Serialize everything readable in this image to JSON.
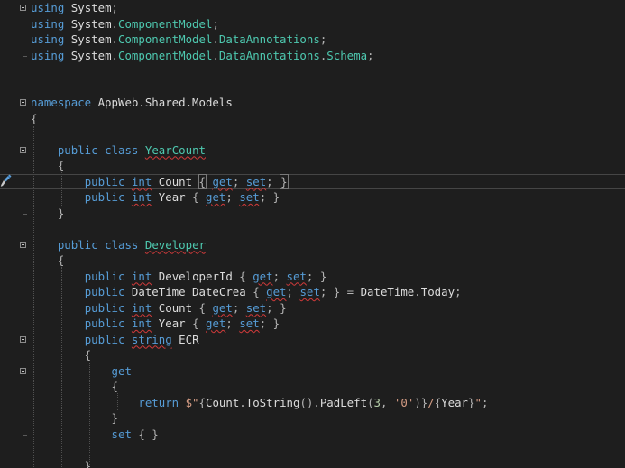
{
  "lines": [
    {
      "row": 0,
      "fold": true,
      "tokens": [
        [
          "kw",
          "using"
        ],
        [
          "id",
          " System"
        ],
        [
          "pn",
          ";"
        ]
      ]
    },
    {
      "row": 1,
      "tokens": [
        [
          "kw",
          "using"
        ],
        [
          "id",
          " System"
        ],
        [
          "pn",
          "."
        ],
        [
          "tp",
          "ComponentModel"
        ],
        [
          "pn",
          ";"
        ]
      ]
    },
    {
      "row": 2,
      "tokens": [
        [
          "kw",
          "using"
        ],
        [
          "id",
          " System"
        ],
        [
          "pn",
          "."
        ],
        [
          "tp",
          "ComponentModel"
        ],
        [
          "pn",
          "."
        ],
        [
          "tp",
          "DataAnnotations"
        ],
        [
          "pn",
          ";"
        ]
      ]
    },
    {
      "row": 3,
      "tokens": [
        [
          "kw",
          "using"
        ],
        [
          "id",
          " System"
        ],
        [
          "pn",
          "."
        ],
        [
          "tp",
          "ComponentModel"
        ],
        [
          "pn",
          "."
        ],
        [
          "tp",
          "DataAnnotations"
        ],
        [
          "pn",
          "."
        ],
        [
          "tp",
          "Schema"
        ],
        [
          "pn",
          ";"
        ]
      ]
    },
    {
      "row": 6,
      "fold": true,
      "tokens": [
        [
          "kw",
          "namespace"
        ],
        [
          "id",
          " AppWeb.Shared.Models"
        ]
      ]
    },
    {
      "row": 7,
      "tokens": [
        [
          "pn",
          "{"
        ]
      ]
    },
    {
      "row": 9,
      "fold": true,
      "tokens": [
        [
          "id",
          "    "
        ],
        [
          "kw",
          "public"
        ],
        [
          "id",
          " "
        ],
        [
          "kw",
          "class"
        ],
        [
          "id",
          " "
        ],
        [
          "tp",
          "YearCount",
          1
        ]
      ]
    },
    {
      "row": 10,
      "tokens": [
        [
          "pn",
          "    {"
        ]
      ]
    },
    {
      "row": 11,
      "current": true,
      "tokens": [
        [
          "id",
          "        "
        ],
        [
          "kw",
          "public"
        ],
        [
          "id",
          " "
        ],
        [
          "kw",
          "int",
          1
        ],
        [
          "id",
          " Count "
        ],
        [
          "pn",
          "{",
          0,
          1
        ],
        [
          "id",
          " "
        ],
        [
          "kw",
          "get",
          1
        ],
        [
          "pn",
          "; "
        ],
        [
          "kw",
          "set",
          1
        ],
        [
          "pn",
          "; "
        ],
        [
          "caret",
          ""
        ],
        [
          "pn",
          "}",
          0,
          1
        ]
      ]
    },
    {
      "row": 12,
      "tokens": [
        [
          "id",
          "        "
        ],
        [
          "kw",
          "public"
        ],
        [
          "id",
          " "
        ],
        [
          "kw",
          "int",
          1
        ],
        [
          "id",
          " Year "
        ],
        [
          "pn",
          "{ "
        ],
        [
          "kw",
          "get",
          1
        ],
        [
          "pn",
          "; "
        ],
        [
          "kw",
          "set",
          1
        ],
        [
          "pn",
          "; }"
        ]
      ]
    },
    {
      "row": 13,
      "tokens": [
        [
          "pn",
          "    }"
        ]
      ]
    },
    {
      "row": 15,
      "fold": true,
      "tokens": [
        [
          "id",
          "    "
        ],
        [
          "kw",
          "public"
        ],
        [
          "id",
          " "
        ],
        [
          "kw",
          "class"
        ],
        [
          "id",
          " "
        ],
        [
          "tp",
          "Developer",
          1
        ]
      ]
    },
    {
      "row": 16,
      "tokens": [
        [
          "pn",
          "    {"
        ]
      ]
    },
    {
      "row": 17,
      "tokens": [
        [
          "id",
          "        "
        ],
        [
          "kw",
          "public"
        ],
        [
          "id",
          " "
        ],
        [
          "kw",
          "int",
          1
        ],
        [
          "id",
          " DeveloperId "
        ],
        [
          "pn",
          "{ "
        ],
        [
          "kw",
          "get",
          1
        ],
        [
          "pn",
          "; "
        ],
        [
          "kw",
          "set",
          1
        ],
        [
          "pn",
          "; }"
        ]
      ]
    },
    {
      "row": 18,
      "tokens": [
        [
          "id",
          "        "
        ],
        [
          "kw",
          "public"
        ],
        [
          "id",
          " DateTime DateCrea "
        ],
        [
          "pn",
          "{ "
        ],
        [
          "kw",
          "get",
          1
        ],
        [
          "pn",
          "; "
        ],
        [
          "kw",
          "set",
          1
        ],
        [
          "pn",
          "; } = "
        ],
        [
          "id",
          "DateTime"
        ],
        [
          "pn",
          "."
        ],
        [
          "id",
          "Today"
        ],
        [
          "pn",
          ";"
        ]
      ]
    },
    {
      "row": 19,
      "tokens": [
        [
          "id",
          "        "
        ],
        [
          "kw",
          "public"
        ],
        [
          "id",
          " "
        ],
        [
          "kw",
          "int",
          1
        ],
        [
          "id",
          " Count "
        ],
        [
          "pn",
          "{ "
        ],
        [
          "kw",
          "get",
          1
        ],
        [
          "pn",
          "; "
        ],
        [
          "kw",
          "set",
          1
        ],
        [
          "pn",
          "; }"
        ]
      ]
    },
    {
      "row": 20,
      "tokens": [
        [
          "id",
          "        "
        ],
        [
          "kw",
          "public"
        ],
        [
          "id",
          " "
        ],
        [
          "kw",
          "int",
          1
        ],
        [
          "id",
          " Year "
        ],
        [
          "pn",
          "{ "
        ],
        [
          "kw",
          "get",
          1
        ],
        [
          "pn",
          "; "
        ],
        [
          "kw",
          "set",
          1
        ],
        [
          "pn",
          "; }"
        ]
      ]
    },
    {
      "row": 21,
      "fold": true,
      "tokens": [
        [
          "id",
          "        "
        ],
        [
          "kw",
          "public"
        ],
        [
          "id",
          " "
        ],
        [
          "kw",
          "string",
          1
        ],
        [
          "id",
          " ECR"
        ]
      ]
    },
    {
      "row": 22,
      "tokens": [
        [
          "pn",
          "        {"
        ]
      ]
    },
    {
      "row": 23,
      "fold": true,
      "tokens": [
        [
          "id",
          "            "
        ],
        [
          "kw",
          "get"
        ]
      ]
    },
    {
      "row": 24,
      "tokens": [
        [
          "pn",
          "            {"
        ]
      ]
    },
    {
      "row": 25,
      "tokens": [
        [
          "id",
          "                "
        ],
        [
          "kw",
          "return"
        ],
        [
          "id",
          " "
        ],
        [
          "str",
          "$\""
        ],
        [
          "pn",
          "{"
        ],
        [
          "id",
          "Count"
        ],
        [
          "pn",
          "."
        ],
        [
          "id",
          "ToString"
        ],
        [
          "pn",
          "()."
        ],
        [
          "id",
          "PadLeft"
        ],
        [
          "pn",
          "("
        ],
        [
          "num",
          "3"
        ],
        [
          "pn",
          ", "
        ],
        [
          "str",
          "'0'"
        ],
        [
          "pn",
          ")}"
        ],
        [
          "str",
          "/"
        ],
        [
          "pn",
          "{"
        ],
        [
          "id",
          "Year"
        ],
        [
          "pn",
          "}"
        ],
        [
          "str",
          "\""
        ],
        [
          "pn",
          ";"
        ]
      ]
    },
    {
      "row": 26,
      "tokens": [
        [
          "pn",
          "            }"
        ]
      ]
    },
    {
      "row": 27,
      "tokens": [
        [
          "id",
          "            "
        ],
        [
          "kw",
          "set"
        ],
        [
          "pn",
          " { }"
        ]
      ]
    },
    {
      "row": 29,
      "tokens": [
        [
          "pn",
          "        }"
        ]
      ]
    }
  ]
}
